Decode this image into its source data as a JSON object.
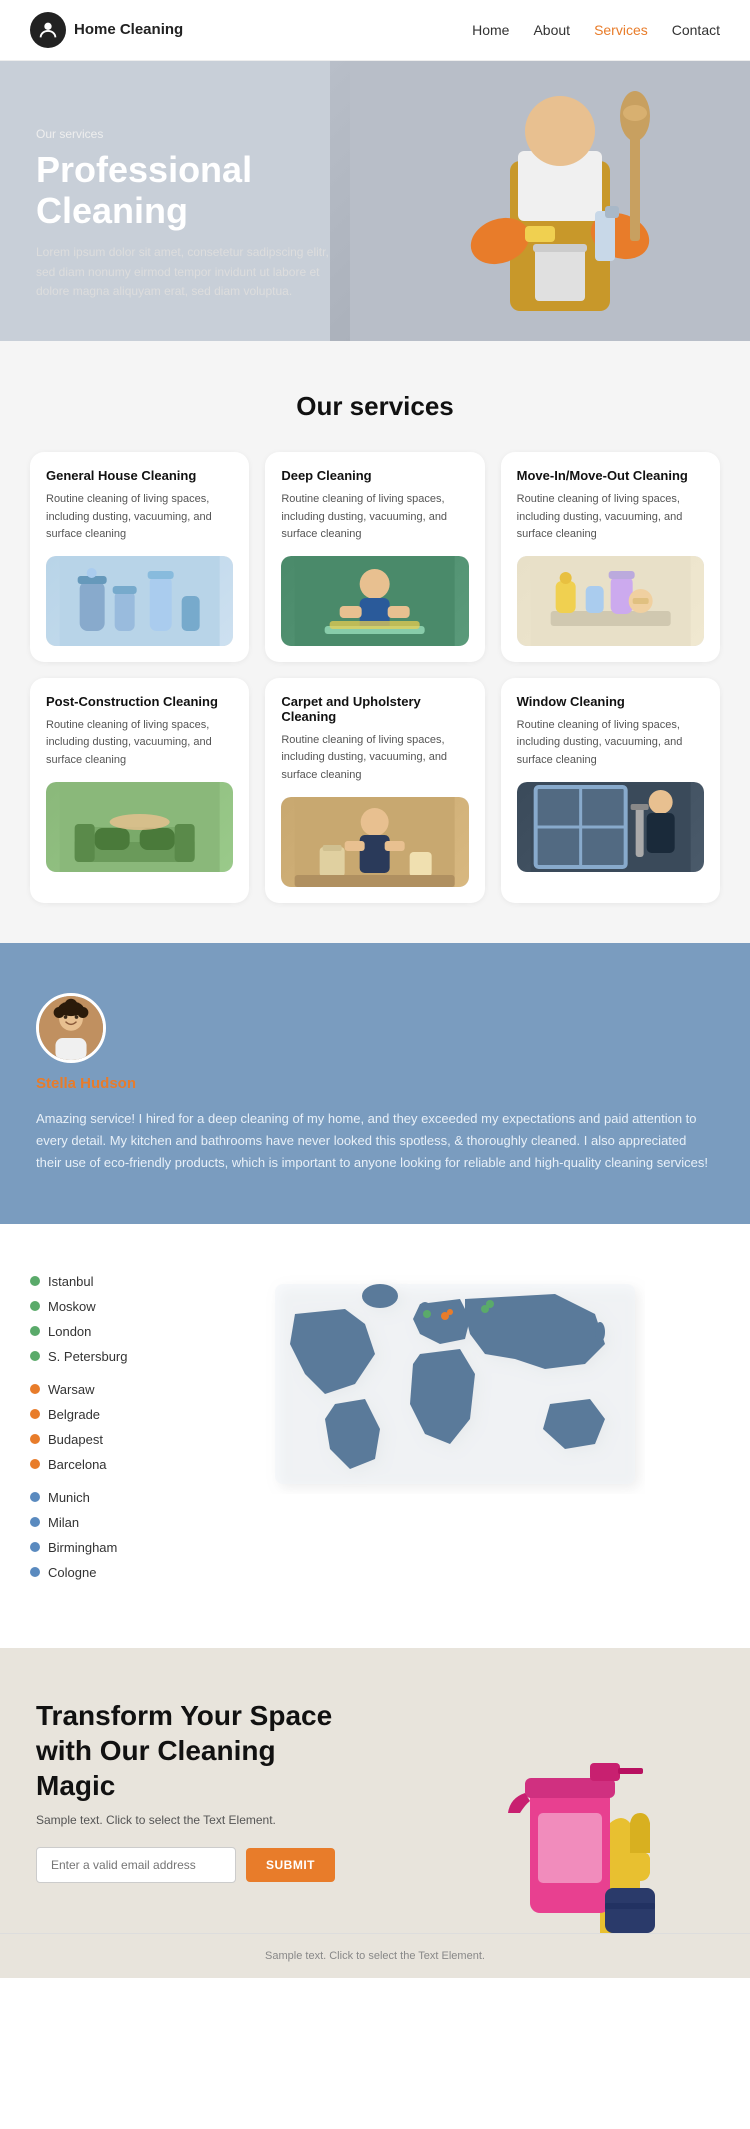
{
  "nav": {
    "logo_text": "Home\nCleaning",
    "links": [
      {
        "label": "Home",
        "active": false
      },
      {
        "label": "About",
        "active": false
      },
      {
        "label": "Services",
        "active": true
      },
      {
        "label": "Contact",
        "active": false
      }
    ]
  },
  "hero": {
    "overline": "Our services",
    "title": "Professional\nCleaning",
    "description": "Lorem ipsum dolor sit amet, consetetur sadipscing elitr, sed diam nonumy eirmod tempor invidunt ut labore et dolore magna aliquyam erat, sed diam voluptua."
  },
  "services_section": {
    "title": "Our services",
    "cards": [
      {
        "title": "General House Cleaning",
        "desc": "Routine cleaning of living spaces, including dusting, vacuuming, and surface cleaning",
        "img_class": "img-general"
      },
      {
        "title": "Deep Cleaning",
        "desc": "Routine cleaning of living spaces, including dusting, vacuuming, and surface cleaning",
        "img_class": "img-deep"
      },
      {
        "title": "Move-In/Move-Out Cleaning",
        "desc": "Routine cleaning of living spaces, including dusting, vacuuming, and surface cleaning",
        "img_class": "img-movein"
      },
      {
        "title": "Post-Construction Cleaning",
        "desc": "Routine cleaning of living spaces, including dusting, vacuuming, and surface cleaning",
        "img_class": "img-postconstruction"
      },
      {
        "title": "Carpet and Upholstery Cleaning",
        "desc": "Routine cleaning of living spaces, including dusting, vacuuming, and surface cleaning",
        "img_class": "img-carpet"
      },
      {
        "title": "Window Cleaning",
        "desc": "Routine cleaning of living spaces, including dusting, vacuuming, and surface cleaning",
        "img_class": "img-window"
      }
    ]
  },
  "testimonial": {
    "name": "Stella Hudson",
    "text": "Amazing service! I hired for a deep cleaning of my home, and they exceeded my expectations and paid attention to every detail. My kitchen and bathrooms have never looked this spotless, & thoroughly cleaned. I also appreciated their use of eco-friendly products, which is important to anyone looking for reliable and high-quality cleaning services!"
  },
  "locations": {
    "cities": [
      {
        "name": "Istanbul",
        "dot": "dot-green"
      },
      {
        "name": "Moskow",
        "dot": "dot-green"
      },
      {
        "name": "London",
        "dot": "dot-green"
      },
      {
        "name": "S. Petersburg",
        "dot": "dot-green"
      },
      {
        "name": "Warsaw",
        "dot": "dot-orange"
      },
      {
        "name": "Belgrade",
        "dot": "dot-orange"
      },
      {
        "name": "Budapest",
        "dot": "dot-orange"
      },
      {
        "name": "Barcelona",
        "dot": "dot-orange"
      },
      {
        "name": "Munich",
        "dot": "dot-blue"
      },
      {
        "name": "Milan",
        "dot": "dot-blue"
      },
      {
        "name": "Birmingham",
        "dot": "dot-blue"
      },
      {
        "name": "Cologne",
        "dot": "dot-blue"
      }
    ]
  },
  "cta": {
    "title": "Transform Your Space with Our Cleaning Magic",
    "subtitle": "Sample text. Click to select the Text Element.",
    "input_placeholder": "Enter a valid email address",
    "button_label": "SUBMIT"
  },
  "footer": {
    "text": "Sample text. Click to select the Text Element."
  }
}
